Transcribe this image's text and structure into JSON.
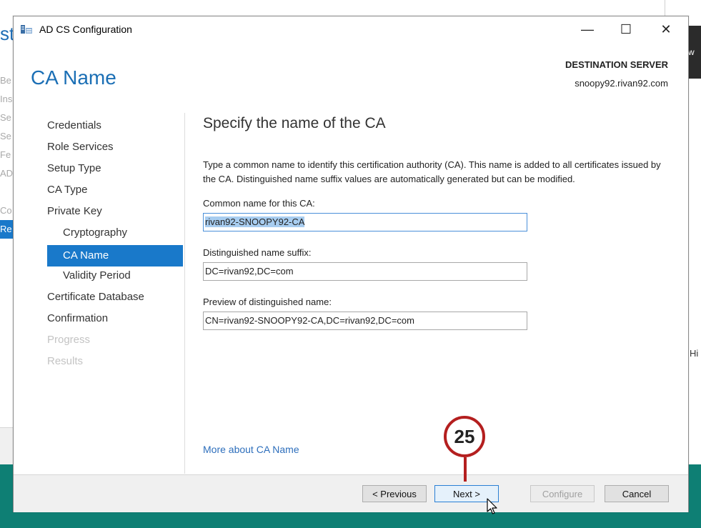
{
  "background": {
    "title_fragment": "st",
    "nav_fragments": [
      "Be",
      "Ins",
      "Se",
      "Se",
      "Fe",
      "AD",
      "",
      "Co",
      "Re"
    ],
    "right_dark_text": "w",
    "right_text_fragment": "Hi"
  },
  "window": {
    "title": "AD CS Configuration",
    "minimize_glyph": "—",
    "maximize_glyph": "☐",
    "close_glyph": "✕"
  },
  "header": {
    "page_title": "CA Name",
    "destination_label": "DESTINATION SERVER",
    "destination_value": "snoopy92.rivan92.com"
  },
  "nav": {
    "items": [
      {
        "label": "Credentials",
        "state": "normal"
      },
      {
        "label": "Role Services",
        "state": "normal"
      },
      {
        "label": "Setup Type",
        "state": "normal"
      },
      {
        "label": "CA Type",
        "state": "normal"
      },
      {
        "label": "Private Key",
        "state": "normal"
      },
      {
        "label": "Cryptography",
        "state": "sub"
      },
      {
        "label": "CA Name",
        "state": "active"
      },
      {
        "label": "Validity Period",
        "state": "sub"
      },
      {
        "label": "Certificate Database",
        "state": "normal"
      },
      {
        "label": "Confirmation",
        "state": "normal"
      },
      {
        "label": "Progress",
        "state": "disabled"
      },
      {
        "label": "Results",
        "state": "disabled"
      }
    ]
  },
  "main": {
    "section_title": "Specify the name of the CA",
    "description": "Type a common name to identify this certification authority (CA). This name is added to all certificates issued by the CA. Distinguished name suffix values are automatically generated but can be modified.",
    "common_name_label": "Common name for this CA:",
    "common_name_value": "rivan92-SNOOPY92-CA",
    "dn_suffix_label": "Distinguished name suffix:",
    "dn_suffix_value": "DC=rivan92,DC=com",
    "preview_label": "Preview of distinguished name:",
    "preview_value": "CN=rivan92-SNOOPY92-CA,DC=rivan92,DC=com",
    "more_link": "More about CA Name"
  },
  "footer": {
    "previous_label": "< Previous",
    "next_label": "Next >",
    "configure_label": "Configure",
    "cancel_label": "Cancel"
  },
  "callout": {
    "step_number": "25",
    "color": "#b41f1f"
  },
  "colors": {
    "accent": "#1979ca",
    "heading": "#1b6fb5",
    "link": "#2e6fbc",
    "teal_footer": "#0e7f74"
  }
}
